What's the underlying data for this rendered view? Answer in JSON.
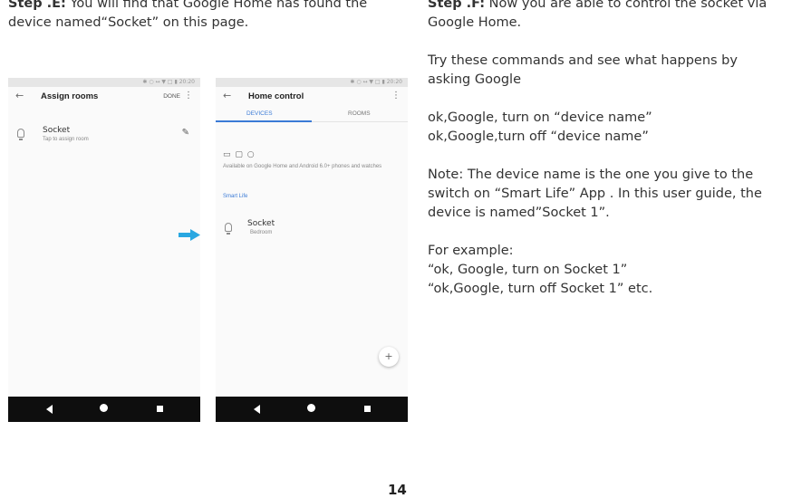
{
  "step_e": {
    "label": "Step .E:",
    "line1_rest": " You will find that Google Home has found the",
    "line2": "device named“Socket” on this page."
  },
  "step_f": {
    "label": "Step .F:",
    "line1_rest": " Now you are able to control the socket via",
    "line2": "Google Home.",
    "try_1": "Try these commands and see what happens by",
    "try_2": "asking Google",
    "cmd_on": "ok,Google, turn on “device name”",
    "cmd_off": "ok,Google,turn off “device name”",
    "note_1": "Note: The device name is the one you give to the",
    "note_2": "switch on “Smart Life” App . In this user guide, the",
    "note_3": "device is named”Socket 1”.",
    "example_label": "For example:",
    "example_1": "“ok, Google, turn on  Socket 1”",
    "example_2": "“ok,Google, turn off  Socket 1” etc."
  },
  "phone_left": {
    "status_icons": "✱ ○ ↔ ▼ □ ▮ 20:20",
    "title": "Assign rooms",
    "done": "DONE",
    "device_name": "Socket",
    "device_sub": "Tap to assign room"
  },
  "phone_right": {
    "status_icons": "✱ ○ ↔ ▼ □ ▮ 20:20",
    "title": "Home control",
    "tab_devices": "DEVICES",
    "tab_rooms": "ROOMS",
    "device_types": "▭ ▢ ○",
    "available_text": "Available on Google Home and Android 6.0+ phones and watches",
    "section_title": "Smart Life",
    "device_name": "Socket",
    "device_sub": "Bedroom",
    "fab_label": "+"
  },
  "page_number": "14",
  "colors": {
    "accent": "#3b7bd6",
    "arrow": "#29a7e1"
  }
}
